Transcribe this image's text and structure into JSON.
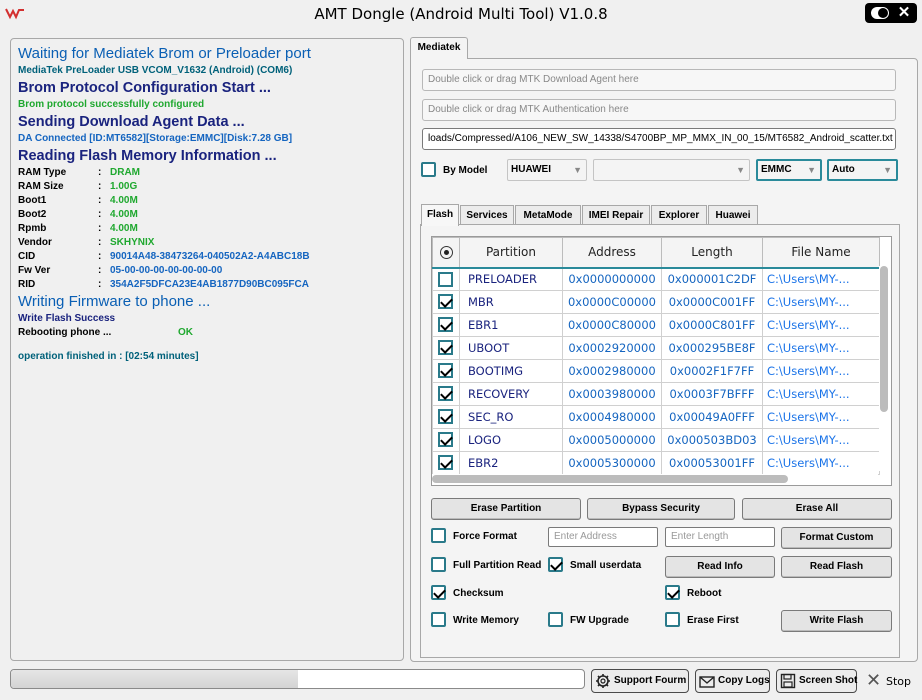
{
  "window": {
    "title": "AMT Dongle (Android Multi Tool) V1.0.8"
  },
  "log": {
    "h1": "Waiting for Mediatek Brom or Preloader port",
    "port": "MediaTek PreLoader USB VCOM_V1632 (Android) (COM6)",
    "h2": "Brom Protocol Configuration Start ...",
    "brom_ok": "Brom protocol successfully configured",
    "h3": "Sending Download Agent Data ...",
    "da": "DA Connected [ID:MT6582][Storage:EMMC][Disk:7.28 GB]",
    "h4": "Reading Flash Memory Information ...",
    "info": [
      {
        "k": "RAM Type",
        "v": "DRAM"
      },
      {
        "k": "RAM Size",
        "v": "1.00G"
      },
      {
        "k": "Boot1",
        "v": "4.00M"
      },
      {
        "k": "Boot2",
        "v": "4.00M"
      },
      {
        "k": "Rpmb",
        "v": "4.00M"
      },
      {
        "k": "Vendor",
        "v": "SKHYNIX"
      },
      {
        "k": "CID",
        "v": "90014A48-38473264-040502A2-A4ABC18B"
      },
      {
        "k": "Fw Ver",
        "v": "05-00-00-00-00-00-00-00"
      },
      {
        "k": "RID",
        "v": "354A2F5DFCA23E4AB1877D90BC095FCA"
      }
    ],
    "sep": ":",
    "h5": "Writing Firmware to phone ...",
    "write_ok": "Write Flash Success",
    "reboot_label": "Rebooting phone ...",
    "reboot_status": "OK",
    "finished": "operation finished in : [02:54 minutes]"
  },
  "main_tab": "Mediatek",
  "fields": {
    "da_placeholder": "Double click or drag MTK Download Agent here",
    "auth_placeholder": "Double click or drag MTK Authentication here",
    "scatter_path": "loads/Compressed/A106_NEW_SW_14338/S4700BP_MP_MMX_IN_00_15/MT6582_Android_scatter.txt"
  },
  "model_row": {
    "by_model_label": "By Model",
    "by_model_checked": false,
    "brand": "HUAWEI",
    "model": "",
    "storage": "EMMC",
    "mode": "Auto"
  },
  "sub_tabs": [
    "Flash",
    "Services",
    "MetaMode",
    "IMEI Repair",
    "Explorer",
    "Huawei"
  ],
  "table": {
    "columns": [
      "Partition",
      "Address",
      "Length",
      "File Name"
    ],
    "rows": [
      {
        "checked": false,
        "name": "PRELOADER",
        "addr": "0x0000000000",
        "len": "0x000001C2DF",
        "file": "C:\\Users\\MY-..."
      },
      {
        "checked": true,
        "name": "MBR",
        "addr": "0x0000C00000",
        "len": "0x0000C001FF",
        "file": "C:\\Users\\MY-..."
      },
      {
        "checked": true,
        "name": "EBR1",
        "addr": "0x0000C80000",
        "len": "0x0000C801FF",
        "file": "C:\\Users\\MY-..."
      },
      {
        "checked": true,
        "name": "UBOOT",
        "addr": "0x0002920000",
        "len": "0x000295BE8F",
        "file": "C:\\Users\\MY-..."
      },
      {
        "checked": true,
        "name": "BOOTIMG",
        "addr": "0x0002980000",
        "len": "0x0002F1F7FF",
        "file": "C:\\Users\\MY-..."
      },
      {
        "checked": true,
        "name": "RECOVERY",
        "addr": "0x0003980000",
        "len": "0x0003F7BFFF",
        "file": "C:\\Users\\MY-..."
      },
      {
        "checked": true,
        "name": "SEC_RO",
        "addr": "0x0004980000",
        "len": "0x00049A0FFF",
        "file": "C:\\Users\\MY-..."
      },
      {
        "checked": true,
        "name": "LOGO",
        "addr": "0x0005000000",
        "len": "0x000503BD03",
        "file": "C:\\Users\\MY-..."
      },
      {
        "checked": true,
        "name": "EBR2",
        "addr": "0x0005300000",
        "len": "0x00053001FF",
        "file": "C:\\Users\\MY-..."
      }
    ]
  },
  "actions": {
    "erase_partition": "Erase Partition",
    "bypass_security": "Bypass Security",
    "erase_all": "Erase All",
    "format_custom": "Format Custom",
    "read_info": "Read Info",
    "read_flash": "Read Flash",
    "write_flash": "Write Flash",
    "address_placeholder": "Enter Address",
    "length_placeholder": "Enter Length"
  },
  "options": {
    "force_format": {
      "label": "Force Format",
      "checked": false
    },
    "full_partition_read": {
      "label": "Full Partition Read",
      "checked": false
    },
    "small_userdata": {
      "label": "Small userdata",
      "checked": true
    },
    "reboot": {
      "label": "Reboot",
      "checked": true
    },
    "checksum": {
      "label": "Checksum",
      "checked": true
    },
    "write_memory": {
      "label": "Write Memory",
      "checked": false
    },
    "fw_upgrade": {
      "label": "FW Upgrade",
      "checked": false
    },
    "erase_first": {
      "label": "Erase First",
      "checked": false
    }
  },
  "bottom": {
    "progress_percent": 50,
    "support": "Support Fourm",
    "copy_logs": "Copy Logs",
    "screenshot": "Screen Shot",
    "stop": "Stop"
  },
  "colors": {
    "accent": "#2a8a9a",
    "log_green": "#1fa82f",
    "log_blue": "#1565c0",
    "log_navy": "#1a237e"
  }
}
